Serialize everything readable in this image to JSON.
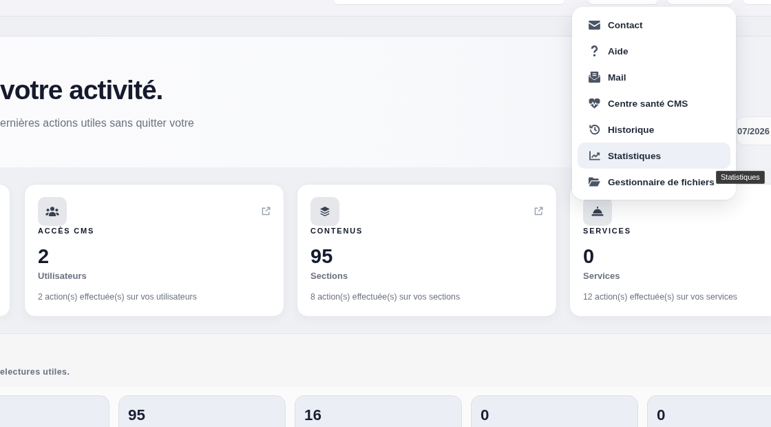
{
  "hero": {
    "heading": "votre activité.",
    "subtitle": "ernières actions utiles sans quitter votre",
    "period": "07/2026"
  },
  "stat_cards": [
    {
      "kind": "partial"
    },
    {
      "kind": "full",
      "label": "ACCÈS CMS",
      "value": "2",
      "unit": "Utilisateurs",
      "activity": "2 action(s) effectuée(s) sur vos utilisateurs",
      "external_link": true
    },
    {
      "kind": "full",
      "label": "CONTENUS",
      "value": "95",
      "unit": "Sections",
      "activity": "8 action(s) effectuée(s) sur vos sections",
      "external_link": true
    },
    {
      "kind": "full",
      "label": "SERVICES",
      "value": "0",
      "unit": "Services",
      "activity": "12 action(s) effectuée(s) sur vos services",
      "external_link": false
    }
  ],
  "section": {
    "subtitle": "electures utiles."
  },
  "count_cards": [
    {
      "kind": "partial"
    },
    {
      "kind": "full",
      "value": "95"
    },
    {
      "kind": "full",
      "value": "16"
    },
    {
      "kind": "full",
      "value": "0"
    },
    {
      "kind": "full",
      "value": "0"
    }
  ],
  "menu": {
    "items": [
      {
        "label": "Contact",
        "selected": false
      },
      {
        "label": "Aide",
        "selected": false
      },
      {
        "label": "Mail",
        "selected": false
      },
      {
        "label": "Centre santé CMS",
        "selected": false
      },
      {
        "label": "Historique",
        "selected": false
      },
      {
        "label": "Statistiques",
        "selected": true
      },
      {
        "label": "Gestionnaire de fichiers",
        "selected": false
      }
    ]
  },
  "tooltip": {
    "text": "Statistiques"
  }
}
